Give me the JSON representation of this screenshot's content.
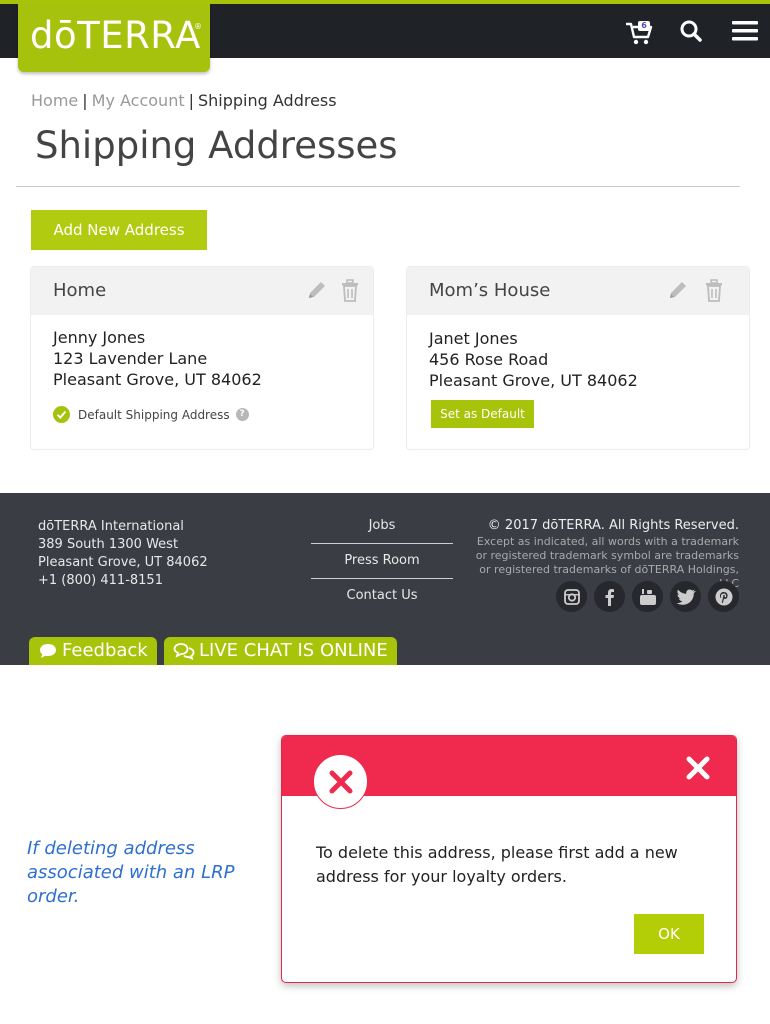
{
  "header": {
    "logo_text": "dōTERRA",
    "logo_mark": "®",
    "cart_count": "6",
    "icons": [
      "cart-icon",
      "search-icon",
      "hamburger-menu-icon"
    ]
  },
  "breadcrumb": {
    "home": "Home",
    "sep": "|",
    "my_account": "My Account",
    "current": "Shipping Address"
  },
  "page_title": "Shipping Addresses",
  "add_button": "Add New Address",
  "addresses": [
    {
      "name": "Home",
      "line1": "Jenny Jones",
      "line2": "123 Lavender Lane",
      "line3": "Pleasant Grove, UT 84062",
      "default_label": "Default Shipping Address",
      "help": "?"
    },
    {
      "name": "Mom’s House",
      "line1": "Janet Jones",
      "line2": "456 Rose Road",
      "line3": "Pleasant Grove, UT 84062",
      "set_default_label": "Set as Default"
    }
  ],
  "footer": {
    "company": "dōTERRA International",
    "street": "389 South 1300 West",
    "city": "Pleasant Grove, UT 84062",
    "phone": "+1 (800) 411-8151",
    "links": [
      "Jobs",
      "Press Room",
      "Contact Us"
    ],
    "copyright": "© 2017 dōTERRA. All Rights Reserved.",
    "legal": "Except as indicated, all words with a trademark or registered trademark symbol are trademarks or registered trademarks of dōTERRA Holdings, LLC",
    "social_icons": [
      "instagram-icon",
      "facebook-icon",
      "youtube-icon",
      "twitter-icon",
      "pinterest-icon"
    ],
    "feedback_label": "Feedback",
    "chat_label": "LIVE CHAT IS ONLINE"
  },
  "annotation": "If deleting address associated with an LRP order.",
  "modal": {
    "message": "To delete this address, please first add a new address for your loyalty orders.",
    "ok_label": "OK"
  },
  "colors": {
    "brand_green": "#a8c40a",
    "dark_bar": "#1f2227",
    "footer_bg": "#3b3d44",
    "alert_red": "#ef2a4e",
    "annotation_blue": "#2e6fd0"
  }
}
